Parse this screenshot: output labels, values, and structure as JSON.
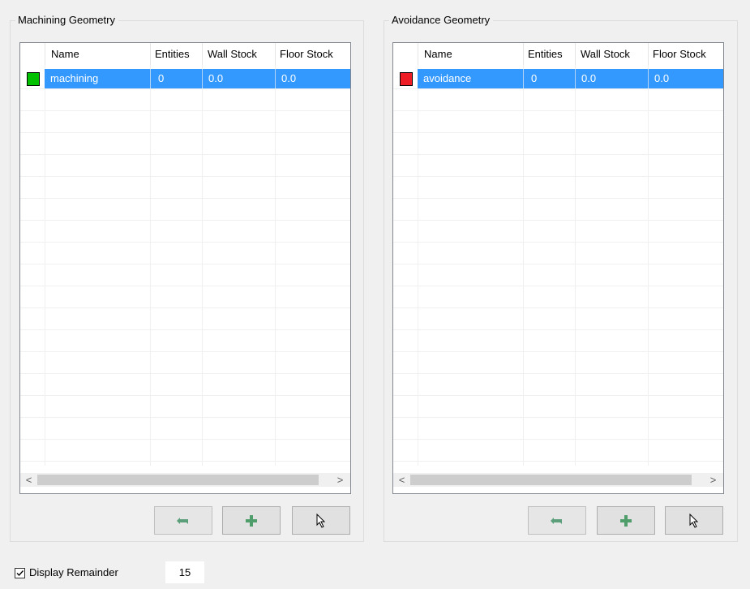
{
  "machining": {
    "title": "Machining Geometry",
    "columns": [
      "",
      "Name",
      "Entities",
      "Wall Stock",
      "Floor Stock"
    ],
    "rows": [
      {
        "color": "#00c000",
        "name": "machining",
        "entities": "0",
        "wall_stock": "0.0",
        "floor_stock": "0.0"
      }
    ],
    "scroll_left": "<",
    "scroll_right": ">"
  },
  "avoidance": {
    "title": "Avoidance Geometry",
    "columns": [
      "",
      "Name",
      "Entities",
      "Wall Stock",
      "Floor Stock"
    ],
    "rows": [
      {
        "color": "#ee1c24",
        "name": "avoidance",
        "entities": "0",
        "wall_stock": "0.0",
        "floor_stock": "0.0"
      }
    ],
    "scroll_left": "<",
    "scroll_right": ">"
  },
  "buttons": {
    "undo_icon": "undo-arrow-icon",
    "add_icon": "plus-icon",
    "select_icon": "cursor-arrow-icon"
  },
  "footer": {
    "display_remainder_label": "Display Remainder",
    "display_remainder_checked": true,
    "remainder_value": "15"
  },
  "colors": {
    "selection": "#3399ff",
    "add_icon": "#4f9d6b",
    "undo_icon": "#5b9f7a"
  }
}
